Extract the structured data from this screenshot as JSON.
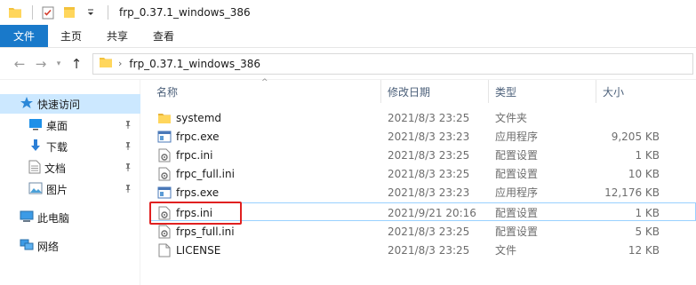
{
  "window": {
    "title": "frp_0.37.1_windows_386"
  },
  "ribbon": {
    "tabs": [
      "文件",
      "主页",
      "共享",
      "查看"
    ]
  },
  "address": {
    "path": "frp_0.37.1_windows_386"
  },
  "sidebar": {
    "items": [
      {
        "label": "快速访问",
        "icon": "star-icon",
        "selected": true
      },
      {
        "label": "桌面",
        "icon": "desktop-icon",
        "pinned": true
      },
      {
        "label": "下载",
        "icon": "download-icon",
        "pinned": true
      },
      {
        "label": "文档",
        "icon": "document-icon",
        "pinned": true
      },
      {
        "label": "图片",
        "icon": "picture-icon",
        "pinned": true
      },
      {
        "label": "此电脑",
        "icon": "computer-icon"
      },
      {
        "label": "网络",
        "icon": "network-icon"
      }
    ]
  },
  "columns": {
    "name": "名称",
    "date": "修改日期",
    "type": "类型",
    "size": "大小"
  },
  "files": [
    {
      "name": "systemd",
      "date": "2021/8/3 23:25",
      "type": "文件夹",
      "size": "",
      "icon": "folder-icon"
    },
    {
      "name": "frpc.exe",
      "date": "2021/8/3 23:23",
      "type": "应用程序",
      "size": "9,205 KB",
      "icon": "exe-icon"
    },
    {
      "name": "frpc.ini",
      "date": "2021/8/3 23:25",
      "type": "配置设置",
      "size": "1 KB",
      "icon": "config-file-icon"
    },
    {
      "name": "frpc_full.ini",
      "date": "2021/8/3 23:25",
      "type": "配置设置",
      "size": "10 KB",
      "icon": "config-file-icon"
    },
    {
      "name": "frps.exe",
      "date": "2021/8/3 23:23",
      "type": "应用程序",
      "size": "12,176 KB",
      "icon": "exe-icon"
    },
    {
      "name": "frps.ini",
      "date": "2021/9/21 20:16",
      "type": "配置设置",
      "size": "1 KB",
      "icon": "config-file-icon",
      "highlighted": true
    },
    {
      "name": "frps_full.ini",
      "date": "2021/8/3 23:25",
      "type": "配置设置",
      "size": "5 KB",
      "icon": "config-file-icon"
    },
    {
      "name": "LICENSE",
      "date": "2021/8/3 23:25",
      "type": "文件",
      "size": "12 KB",
      "icon": "file-icon"
    }
  ],
  "colors": {
    "accent": "#1979ca",
    "selection": "#cce8ff",
    "annotation": "#e02020"
  }
}
